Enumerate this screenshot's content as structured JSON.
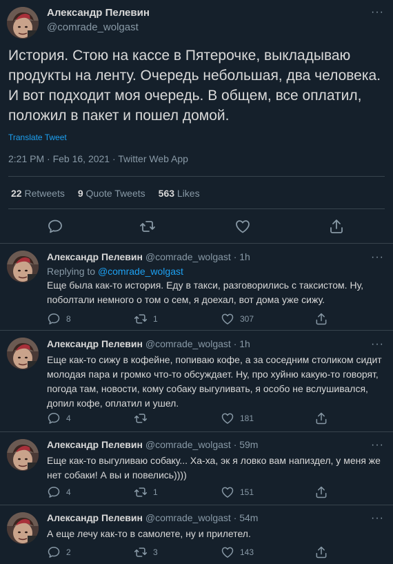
{
  "main": {
    "author_name": "Александр Пелевин",
    "author_handle": "@comrade_wolgast",
    "text": "История. Стою на кассе в Пятерочке, выкладываю продукты на ленту. Очередь небольшая, два человека. И вот подходит моя очередь. В общем, все оплатил, положил в пакет и пошел домой.",
    "translate_label": "Translate Tweet",
    "timestamp": "2:21 PM · Feb 16, 2021 · Twitter Web App",
    "retweets_count": "22",
    "retweets_label": "Retweets",
    "quotes_count": "9",
    "quotes_label": "Quote Tweets",
    "likes_count": "563",
    "likes_label": "Likes"
  },
  "replies": [
    {
      "name": "Александр Пелевин",
      "handle": "@comrade_wolgast",
      "time": "· 1h",
      "replying_prefix": "Replying to",
      "replying_to": "@comrade_wolgast",
      "text": "Еще была как-то история. Еду в такси, разговорились с таксистом. Ну, поболтали немного о том о сем, я доехал, вот дома уже сижу.",
      "replies": "8",
      "retweets": "1",
      "likes": "307"
    },
    {
      "name": "Александр Пелевин",
      "handle": "@comrade_wolgast",
      "time": "· 1h",
      "text": "Еще как-то сижу в кофейне, попиваю кофе, а за соседним столиком сидит молодая пара и громко что-то обсуждает. Ну, про хуйню какую-то говорят, погода там, новости, кому собаку выгуливать, я особо не вслушивался, допил кофе, оплатил и ушел.",
      "replies": "4",
      "retweets": "",
      "likes": "181"
    },
    {
      "name": "Александр Пелевин",
      "handle": "@comrade_wolgast",
      "time": "· 59m",
      "text": "Еще как-то выгуливаю собаку... Ха-ха, эк я ловко вам напиздел, у меня же нет собаки! А вы и повелись))))",
      "replies": "4",
      "retweets": "1",
      "likes": "151"
    },
    {
      "name": "Александр Пелевин",
      "handle": "@comrade_wolgast",
      "time": "· 54m",
      "text": "А еще лечу как-то в самолете, ну и прилетел.",
      "replies": "2",
      "retweets": "3",
      "likes": "143"
    }
  ],
  "icons": {
    "reply": "reply-icon",
    "retweet": "retweet-icon",
    "like": "heart-icon",
    "share": "share-icon",
    "more": "more-icon"
  },
  "colors": {
    "background": "#15202b",
    "link": "#1da1f2",
    "secondary_text": "#8899a6",
    "primary_text": "#d9d9d9",
    "divider": "#38444d"
  }
}
